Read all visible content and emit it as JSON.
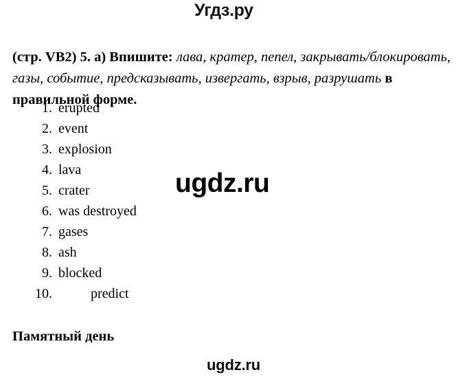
{
  "site": {
    "top_logo": "Угдз.ру",
    "watermark_center": "ugdz.ru",
    "watermark_bottom": "ugdz.ru"
  },
  "task": {
    "lead": "(стр. VB2) 5. а) Впишите: ",
    "words": "лава, кратер, пепел, закрывать/блокировать, газы, событие, предсказывать, извергать, взрыв, разрушать",
    "tail": " в правильной форме."
  },
  "answers": [
    {
      "num": "1.",
      "text": "erupted"
    },
    {
      "num": "2.",
      "text": "event"
    },
    {
      "num": "3.",
      "text": "explosion"
    },
    {
      "num": "4.",
      "text": "lava"
    },
    {
      "num": "5.",
      "text": "crater"
    },
    {
      "num": "6.",
      "text": "was destroyed"
    },
    {
      "num": "7.",
      "text": "gases"
    },
    {
      "num": "8.",
      "text": "ash"
    },
    {
      "num": "9.",
      "text": "blocked"
    },
    {
      "num": "10.",
      "text": "predict"
    }
  ],
  "section": {
    "heading": "Памятный день"
  },
  "colors": {
    "text": "#000000",
    "background": "#ffffff"
  }
}
